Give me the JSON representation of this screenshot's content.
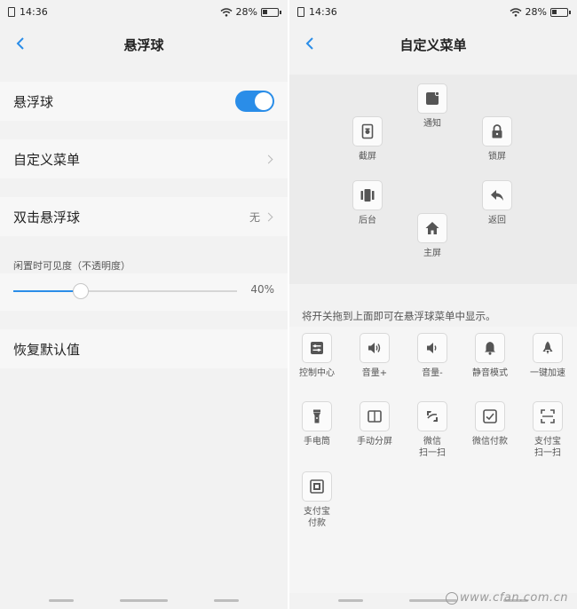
{
  "status_bar": {
    "time": "14:36",
    "battery_percent": "28%"
  },
  "left": {
    "title": "悬浮球",
    "floating_ball": {
      "label": "悬浮球",
      "enabled": true
    },
    "custom_menu": {
      "label": "自定义菜单"
    },
    "double_tap": {
      "label": "双击悬浮球",
      "value": "无"
    },
    "visibility": {
      "label": "闲置时可见度（不透明度）",
      "value_text": "40%",
      "level": 0.3
    },
    "restore": {
      "label": "恢复默认值"
    }
  },
  "right": {
    "title": "自定义菜单",
    "menu_items": [
      {
        "label": "通知",
        "icon": "notification-icon"
      },
      {
        "label": "截屏",
        "icon": "screenshot-icon"
      },
      {
        "label": "锁屏",
        "icon": "lock-icon"
      },
      {
        "label": "后台",
        "icon": "recent-apps-icon"
      },
      {
        "label": "返回",
        "icon": "back-arrow-icon"
      },
      {
        "label": "主屏",
        "icon": "home-icon"
      }
    ],
    "hint": "将开关拖到上面即可在悬浮球菜单中显示。",
    "options": [
      {
        "label": "控制中心",
        "icon": "control-center-icon"
      },
      {
        "label": "音量+",
        "icon": "volume-up-icon"
      },
      {
        "label": "音量-",
        "icon": "volume-down-icon"
      },
      {
        "label": "静音模式",
        "icon": "bell-icon"
      },
      {
        "label": "一键加速",
        "icon": "rocket-icon"
      },
      {
        "label": "手电筒",
        "icon": "flashlight-icon"
      },
      {
        "label": "手动分屏",
        "icon": "split-screen-icon"
      },
      {
        "label": "微信\n扫一扫",
        "icon": "wechat-scan-icon"
      },
      {
        "label": "微信付款",
        "icon": "wechat-pay-icon"
      },
      {
        "label": "支付宝\n扫一扫",
        "icon": "alipay-scan-icon"
      },
      {
        "label": "支付宝\n付款",
        "icon": "alipay-pay-icon"
      }
    ]
  },
  "watermark": "www.cfan.com.cn",
  "colors": {
    "accent": "#2a8de8",
    "background": "#f2f2f2",
    "row": "#f7f7f7"
  }
}
